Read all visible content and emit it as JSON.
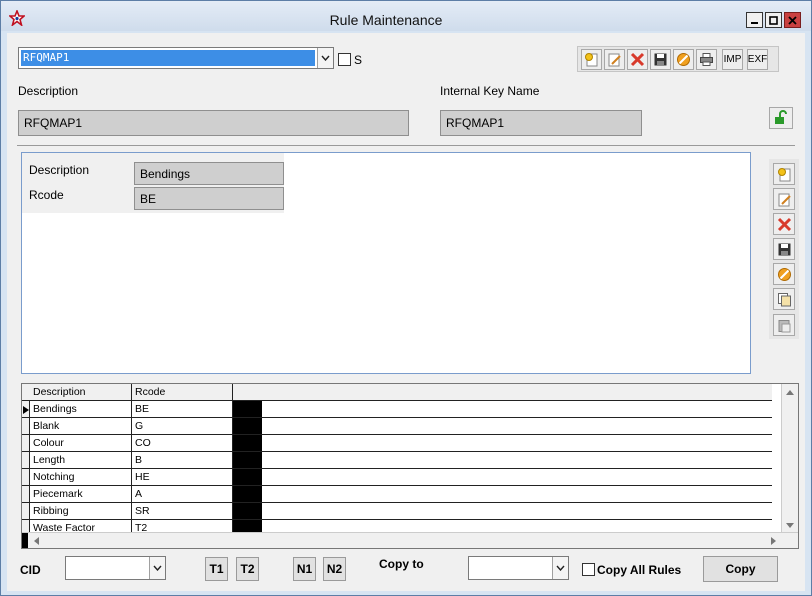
{
  "window": {
    "title": "Rule Maintenance"
  },
  "top": {
    "rule_combo_value": "RFQMAP1",
    "s_checkbox_label": "S",
    "description_label": "Description",
    "description_value": "RFQMAP1",
    "internal_key_label": "Internal Key Name",
    "internal_key_value": "RFQMAP1"
  },
  "toolbar": {
    "imp_label": "IMP",
    "exf_label": "EXF"
  },
  "detail": {
    "description_label": "Description",
    "description_value": "Bendings",
    "rcode_label": "Rcode",
    "rcode_value": "BE"
  },
  "grid": {
    "columns": [
      "Description",
      "Rcode"
    ],
    "rows": [
      [
        "Bendings",
        "BE"
      ],
      [
        "Blank",
        "G"
      ],
      [
        "Colour",
        "CO"
      ],
      [
        "Length",
        "B"
      ],
      [
        "Notching",
        "HE"
      ],
      [
        "Piecemark",
        "A"
      ],
      [
        "Ribbing",
        "SR"
      ],
      [
        "Waste Factor",
        "T2"
      ]
    ]
  },
  "bottom": {
    "cid_label": "CID",
    "cid_value": "",
    "t1": "T1",
    "t2": "T2",
    "n1": "N1",
    "n2": "N2",
    "copy_to_label": "Copy to",
    "copy_to_value": "",
    "copy_all_label": "Copy All Rules",
    "copy_button": "Copy"
  },
  "colors": {
    "selection": "#3d8ee6",
    "close_button": "#c94141",
    "delete_icon": "#d83a2c",
    "cancel_icon": "#f0a020",
    "unlock_icon": "#2a9a2a"
  },
  "icons": [
    "star-app-icon",
    "new-icon",
    "edit-icon",
    "delete-icon",
    "save-icon",
    "cancel-icon",
    "print-icon",
    "unlock-icon",
    "copy-icon",
    "paste-icon"
  ]
}
